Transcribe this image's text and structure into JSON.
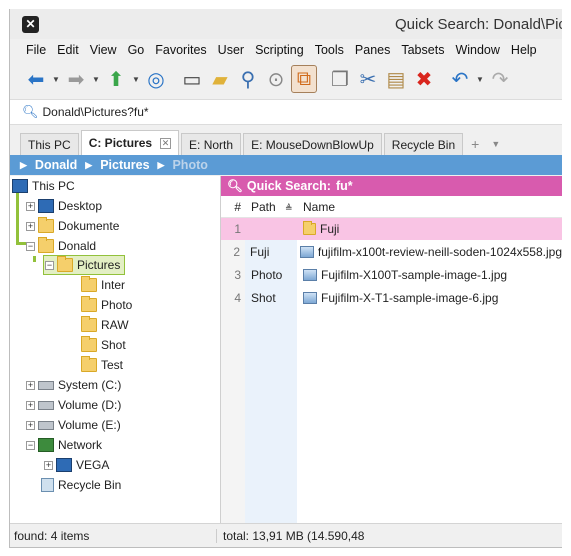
{
  "window": {
    "title": "Quick Search: Donald\\Pic"
  },
  "menu": [
    "File",
    "Edit",
    "View",
    "Go",
    "Favorites",
    "User",
    "Scripting",
    "Tools",
    "Panes",
    "Tabsets",
    "Window",
    "Help"
  ],
  "address": {
    "value": "Donald\\Pictures?fu*"
  },
  "tabs": [
    {
      "label": "This PC"
    },
    {
      "label": "C: Pictures"
    },
    {
      "label": "E: North"
    },
    {
      "label": "E: MouseDownBlowUp"
    },
    {
      "label": "Recycle Bin"
    }
  ],
  "breadcrumb": [
    "Donald",
    "Pictures",
    "Photo"
  ],
  "tree": {
    "this_pc": "This PC",
    "desktop": "Desktop",
    "dokumente": "Dokumente",
    "donald": "Donald",
    "pictures": "Pictures",
    "inter": "Inter",
    "photo": "Photo",
    "raw": "RAW",
    "shot": "Shot",
    "test": "Test",
    "system": "System (C:)",
    "vol_d": "Volume (D:)",
    "vol_e": "Volume (E:)",
    "network": "Network",
    "vega": "VEGA",
    "recycle": "Recycle Bin"
  },
  "quick_search": {
    "label": "Quick Search:",
    "query": "fu*"
  },
  "columns": {
    "num": "#",
    "path": "Path",
    "name": "Name"
  },
  "rows": [
    {
      "num": "1",
      "path": "",
      "name": "Fuji"
    },
    {
      "num": "2",
      "path": "Fuji",
      "name": "fujifilm-x100t-review-neill-soden-1024x558.jpg"
    },
    {
      "num": "3",
      "path": "Photo",
      "name": "Fujifilm-X100T-sample-image-1.jpg"
    },
    {
      "num": "4",
      "path": "Shot",
      "name": "Fujifilm-X-T1-sample-image-6.jpg"
    }
  ],
  "status": {
    "left": "found: 4 items",
    "right": "total: 13,91 MB (14.590,48"
  },
  "colors": {
    "breadcrumb_bg": "#5b9bd5",
    "quick_search_bg": "#d85bae",
    "highlight_row": "#f9c4e4",
    "tree_selection": "#92c13b"
  }
}
